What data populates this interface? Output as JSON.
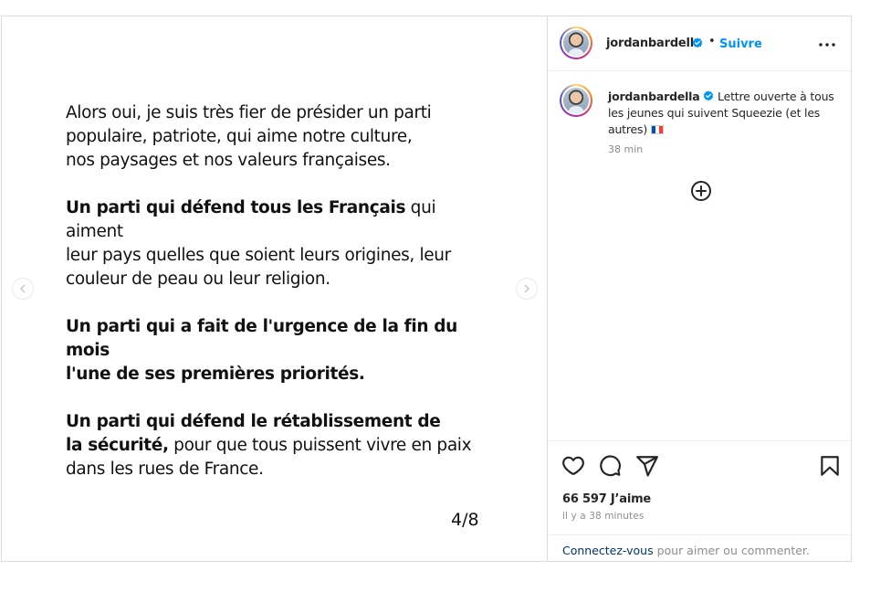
{
  "letter": {
    "paragraph1": "Alors oui, je suis très fier de présider un parti\npopulaire, patriote, qui aime notre culture,\nnos paysages et nos valeurs françaises.",
    "paragraph2_bold": "Un parti qui défend tous les Français",
    "paragraph2_rest": " qui aiment\nleur pays quelles que soient leurs origines, leur\ncouleur de peau ou leur religion.",
    "paragraph3_bold": "Un parti qui a fait de l'urgence de la fin du mois\nl'une de ses premières priorités.",
    "paragraph4_bold": "Un parti qui défend le rétablissement de\nla sécurité,",
    "paragraph4_rest": " pour que tous puissent vivre en paix\ndans les rues de France.",
    "page_counter": "4/8"
  },
  "header": {
    "username": "jordanbardella",
    "separator": "•",
    "follow_label": "Suivre"
  },
  "caption": {
    "username": "jordanbardella",
    "text": " Lettre ouverte à tous les jeunes qui suivent Squeezie (et les autres) ",
    "time": "38 min"
  },
  "stats": {
    "likes": "66 597 J’aime",
    "posted": "il y a 38 minutes"
  },
  "login": {
    "link_label": "Connectez-vous",
    "rest": " pour aimer ou commenter."
  },
  "icons": {
    "verified": "verified-badge-icon",
    "more": "more-options-icon",
    "add_comment": "plus-circle-icon",
    "like": "heart-icon",
    "comment": "comment-bubble-icon",
    "share": "paper-plane-icon",
    "save": "bookmark-icon",
    "prev": "chevron-left-icon",
    "next": "chevron-right-icon",
    "flag": "flag-france-icon"
  },
  "colors": {
    "link_blue": "#0095f6",
    "verified_blue": "#0095f6",
    "muted_text": "#8e8e8e",
    "border": "#dbdbdb"
  }
}
